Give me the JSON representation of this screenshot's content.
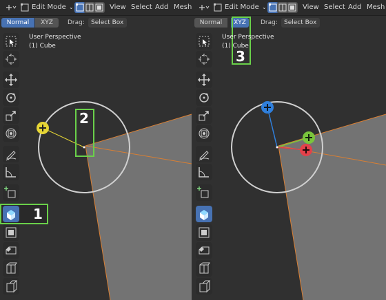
{
  "header": {
    "mode_label": "Edit Mode",
    "menu": [
      "View",
      "Select",
      "Add",
      "Mesh"
    ]
  },
  "subheader": {
    "orientation_normal": "Normal",
    "orientation_xyz": "XYZ",
    "drag_label": "Drag:",
    "drag_value": "Select Box"
  },
  "viewport": {
    "perspective": "User Perspective",
    "object": "(1) Cube"
  },
  "toolbar": {
    "tools": [
      "select-box",
      "cursor",
      "move",
      "rotate",
      "scale",
      "transform",
      "annotate",
      "measure",
      "add-cube",
      "extrude-region",
      "inset-faces",
      "bevel",
      "loop-cut",
      "knife"
    ],
    "active_tool": "extrude-region"
  },
  "callouts": {
    "left_primary": "1",
    "left_secondary": "2",
    "right_primary": "3"
  },
  "colors": {
    "accent": "#4772b3",
    "highlight": "#6ad14a",
    "gizmo_view": "#e5d535",
    "axis_x": "#e2414a",
    "axis_y": "#7ac43c",
    "axis_z": "#2f7fdc",
    "edge_orange": "#d97f33",
    "face_gray": "#737373"
  }
}
